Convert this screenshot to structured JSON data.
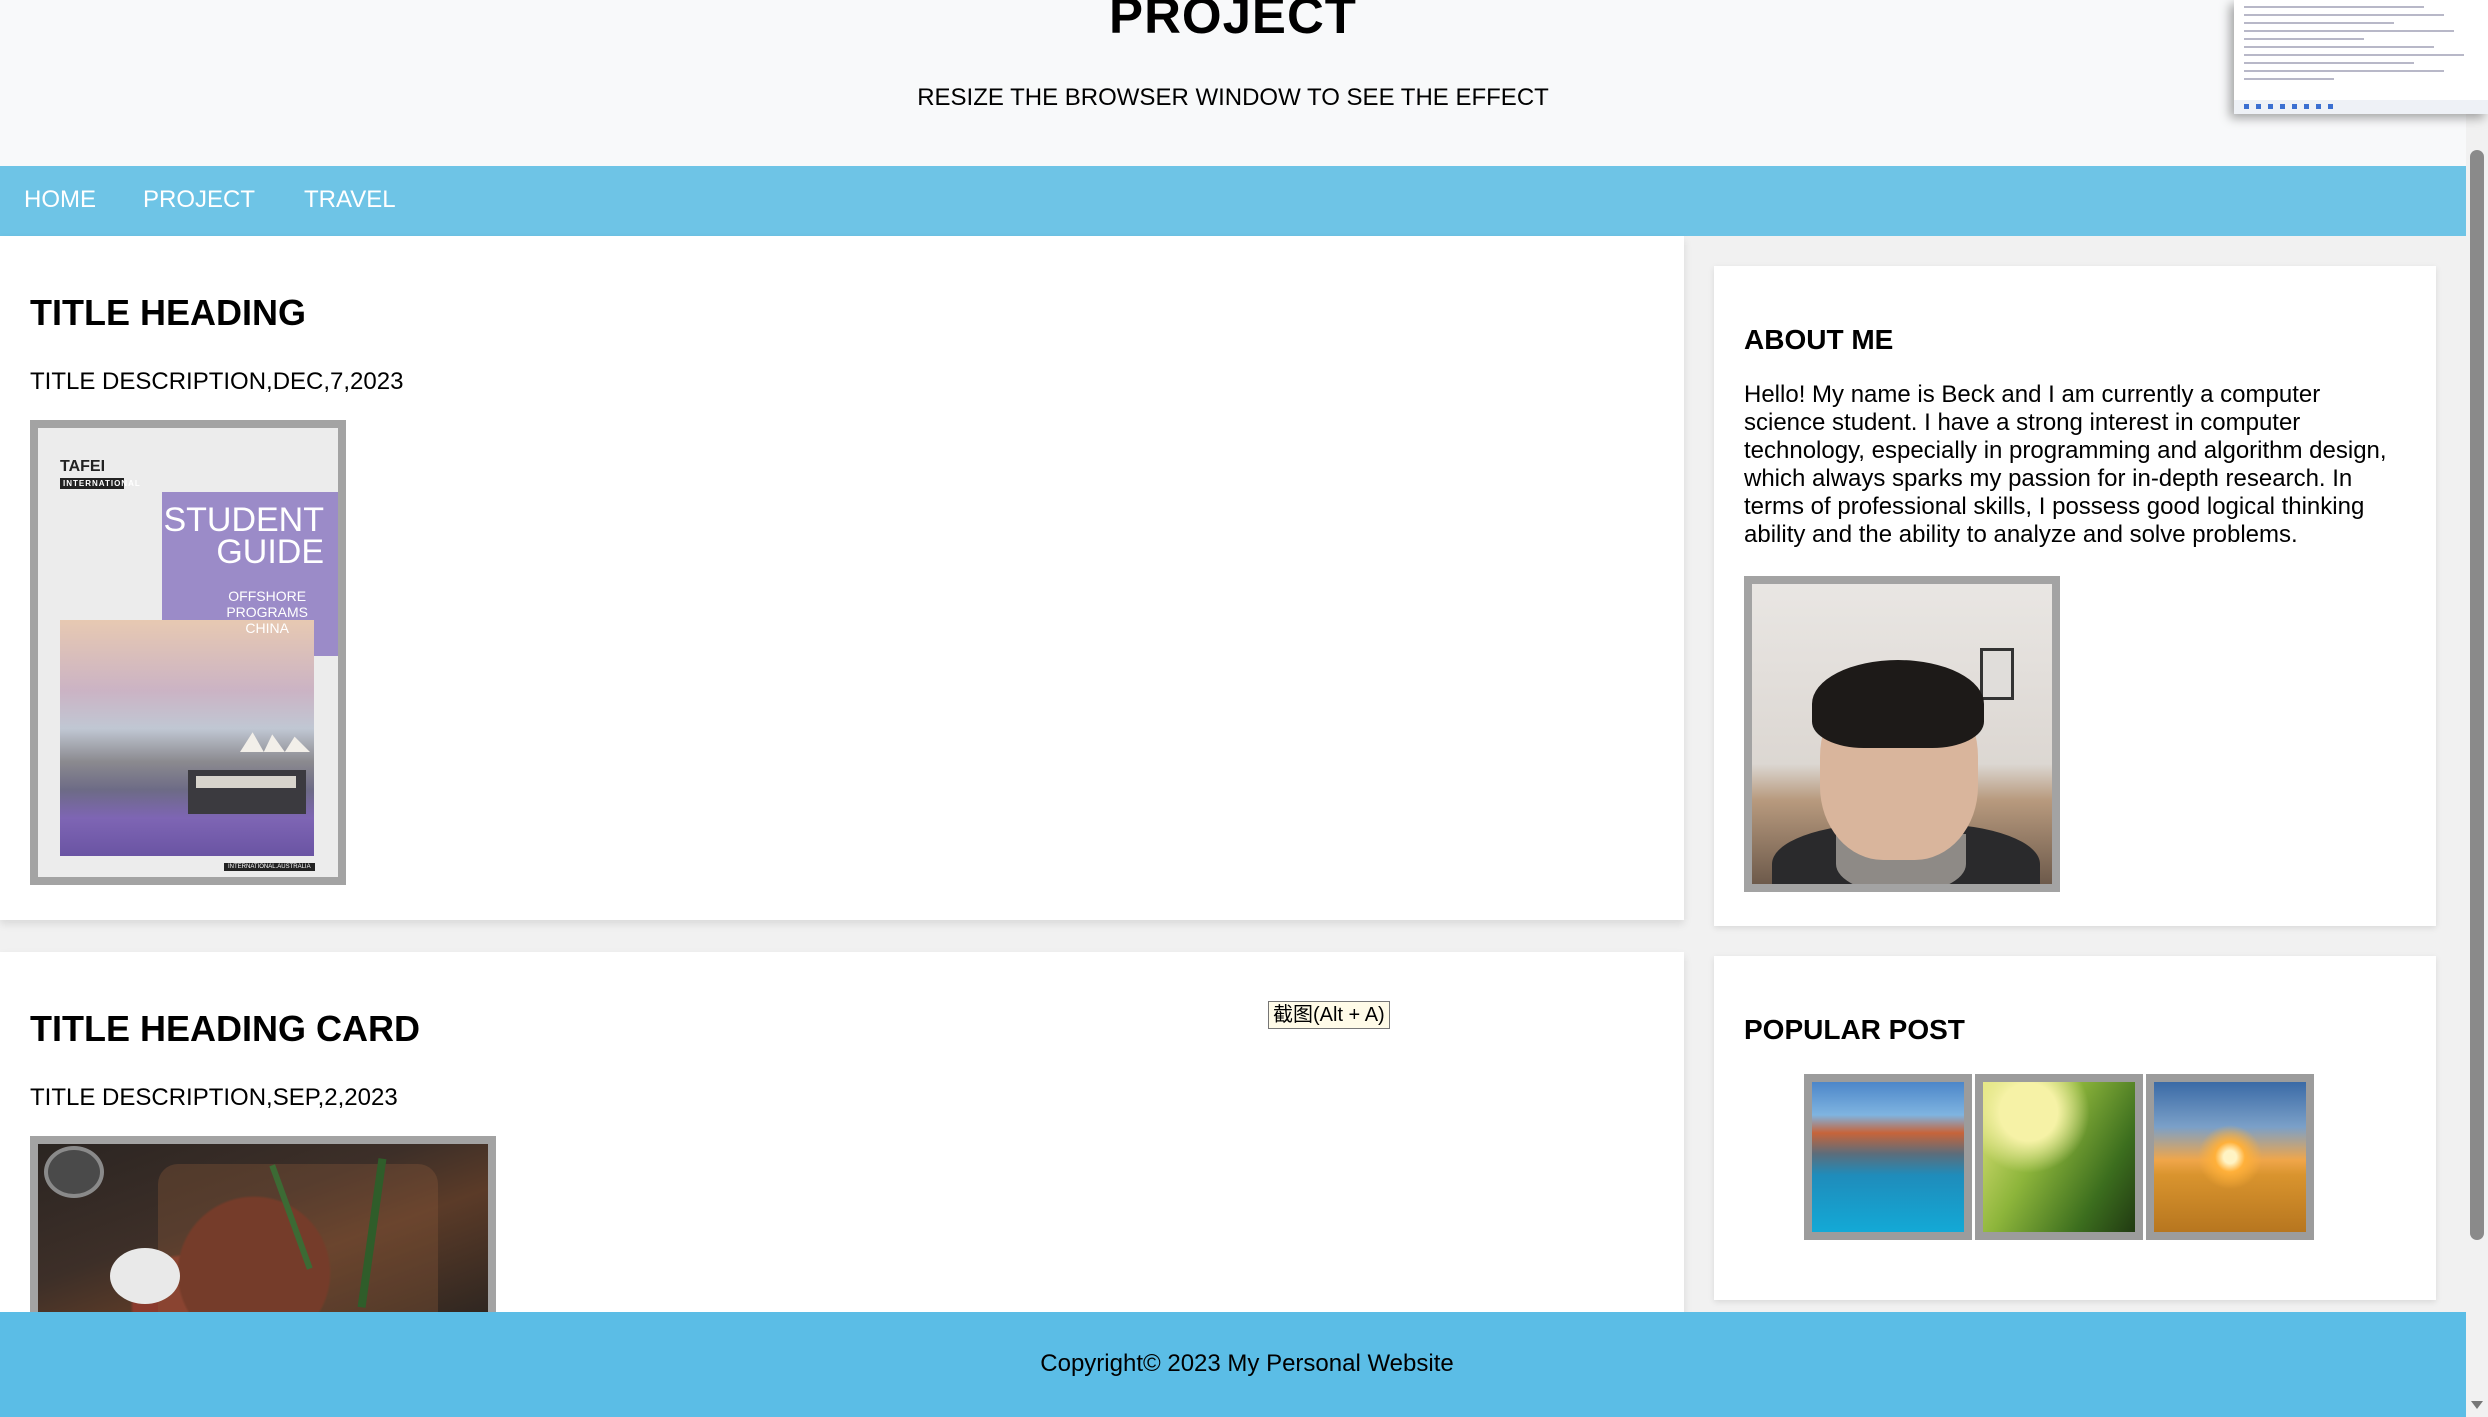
{
  "header": {
    "title": "PROJECT",
    "subtitle": "RESIZE THE BROWSER WINDOW TO SEE THE EFFECT"
  },
  "nav": {
    "items": [
      {
        "label": "HOME"
      },
      {
        "label": "PROJECT"
      },
      {
        "label": "TRAVEL"
      }
    ]
  },
  "main": {
    "cards": [
      {
        "heading": "TITLE HEADING",
        "description": "TITLE DESCRIPTION,DEC,7,2023",
        "image": {
          "logo": "TAFEI",
          "logo_sub": "INTERNATIONAL",
          "title_line1": "STUDENT",
          "title_line2": "GUIDE",
          "sub_line1": "OFFSHORE",
          "sub_line2": "PROGRAMS",
          "sub_line3": "CHINA",
          "footer": "INTERNATIONAL.AUSTRALIA"
        }
      },
      {
        "heading": "TITLE HEADING CARD",
        "description": "TITLE DESCRIPTION,SEP,2,2023"
      }
    ]
  },
  "sidebar": {
    "about": {
      "heading": "ABOUT ME",
      "text": "Hello! My name is Beck and I am currently a computer science student. I have a strong interest in computer technology, especially in programming and algorithm design, which always sparks my passion for in-depth research. In terms of professional skills, I possess good logical thinking ability and the ability to analyze and solve problems."
    },
    "popular": {
      "heading": "POPULAR POST",
      "thumbnails": [
        "mountain-lake",
        "sunlit-forest",
        "sunset-field"
      ]
    }
  },
  "tooltip": "截图(Alt + A)",
  "footer": {
    "text": "Copyright© 2023 My Personal Website"
  },
  "colors": {
    "nav_bg": "#6ec4e6",
    "footer_bg": "#5bbde6",
    "header_bg": "#f8f9fa",
    "image_border": "#a3a3a3"
  }
}
